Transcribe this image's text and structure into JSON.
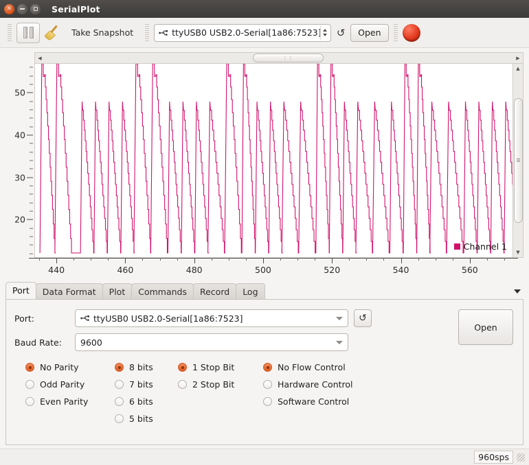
{
  "window": {
    "title": "SerialPlot",
    "close_icon": "close-icon",
    "minimize_icon": "minimize-icon",
    "maximize_icon": "maximize-icon"
  },
  "toolbar": {
    "pause_icon": "pause-icon",
    "clear_icon": "broom-clear-icon",
    "snapshot_label": "Take Snapshot",
    "port_value": "ttyUSB0 USB2.0-Serial[1a86:7523]",
    "usb_icon": "usb-icon",
    "refresh_icon": "refresh-icon",
    "refresh_glyph": "↺",
    "open_label": "Open",
    "record_icon": "record-led-icon"
  },
  "plot": {
    "legend_label": "Channel 1",
    "series_color": "#d2116b",
    "background": "#ffffff",
    "hscroll_left_glyph": "◀",
    "hscroll_right_glyph": "▶",
    "hscroll_grip": "⋮⋮",
    "vscroll_up_glyph": "▲",
    "vscroll_down_glyph": "▼"
  },
  "chart_data": {
    "type": "line",
    "title": "",
    "xlabel": "",
    "ylabel": "",
    "xlim": [
      432,
      574
    ],
    "ylim": [
      11,
      57
    ],
    "xticks": [
      440,
      460,
      480,
      500,
      520,
      540,
      560
    ],
    "yticks": [
      20,
      30,
      40,
      50
    ],
    "grid": false,
    "legend_position": "bottom-right",
    "series": [
      {
        "name": "Channel 1",
        "color": "#d2116b",
        "description": "Sawtooth sensor waveform: fast rise to peak then stepped decay, repeating roughly every 4-5 x-units",
        "peaks_x": [
          434,
          438.5,
          446,
          450,
          454,
          458,
          462,
          467,
          472,
          476,
          480,
          484,
          489,
          494,
          498,
          502,
          506,
          511,
          516,
          520,
          524,
          528,
          533,
          538,
          542,
          546,
          550,
          555,
          560,
          564,
          568,
          572
        ],
        "peaks_y": [
          57,
          57,
          48,
          48,
          48,
          48,
          57,
          57,
          48,
          48,
          48,
          48,
          57,
          57,
          48,
          48,
          48,
          48,
          57,
          57,
          48,
          48,
          48,
          48,
          57,
          57,
          48,
          48,
          48,
          48,
          48,
          48
        ],
        "troughs_y": 12
      }
    ]
  },
  "tabs": {
    "items": [
      {
        "label": "Port",
        "active": true
      },
      {
        "label": "Data Format",
        "active": false
      },
      {
        "label": "Plot",
        "active": false
      },
      {
        "label": "Commands",
        "active": false
      },
      {
        "label": "Record",
        "active": false
      },
      {
        "label": "Log",
        "active": false
      }
    ],
    "menu_icon": "chevron-down-icon"
  },
  "port_panel": {
    "port_label": "Port:",
    "port_value": "ttyUSB0 USB2.0-Serial[1a86:7523]",
    "baud_label": "Baud Rate:",
    "baud_value": "9600",
    "refresh_icon": "refresh-icon",
    "refresh_glyph": "↺",
    "open_label": "Open",
    "parity": [
      {
        "label": "No Parity",
        "selected": true
      },
      {
        "label": "Odd Parity",
        "selected": false
      },
      {
        "label": "Even Parity",
        "selected": false
      }
    ],
    "data_bits": [
      {
        "label": "8 bits",
        "selected": true
      },
      {
        "label": "7 bits",
        "selected": false
      },
      {
        "label": "6 bits",
        "selected": false
      },
      {
        "label": "5 bits",
        "selected": false
      }
    ],
    "stop_bits": [
      {
        "label": "1 Stop Bit",
        "selected": true
      },
      {
        "label": "2 Stop Bit",
        "selected": false
      }
    ],
    "flow_control": [
      {
        "label": "No Flow Control",
        "selected": true
      },
      {
        "label": "Hardware Control",
        "selected": false
      },
      {
        "label": "Software Control",
        "selected": false
      }
    ]
  },
  "statusbar": {
    "sps": "960sps",
    "grip_icon": "resize-grip-icon"
  }
}
